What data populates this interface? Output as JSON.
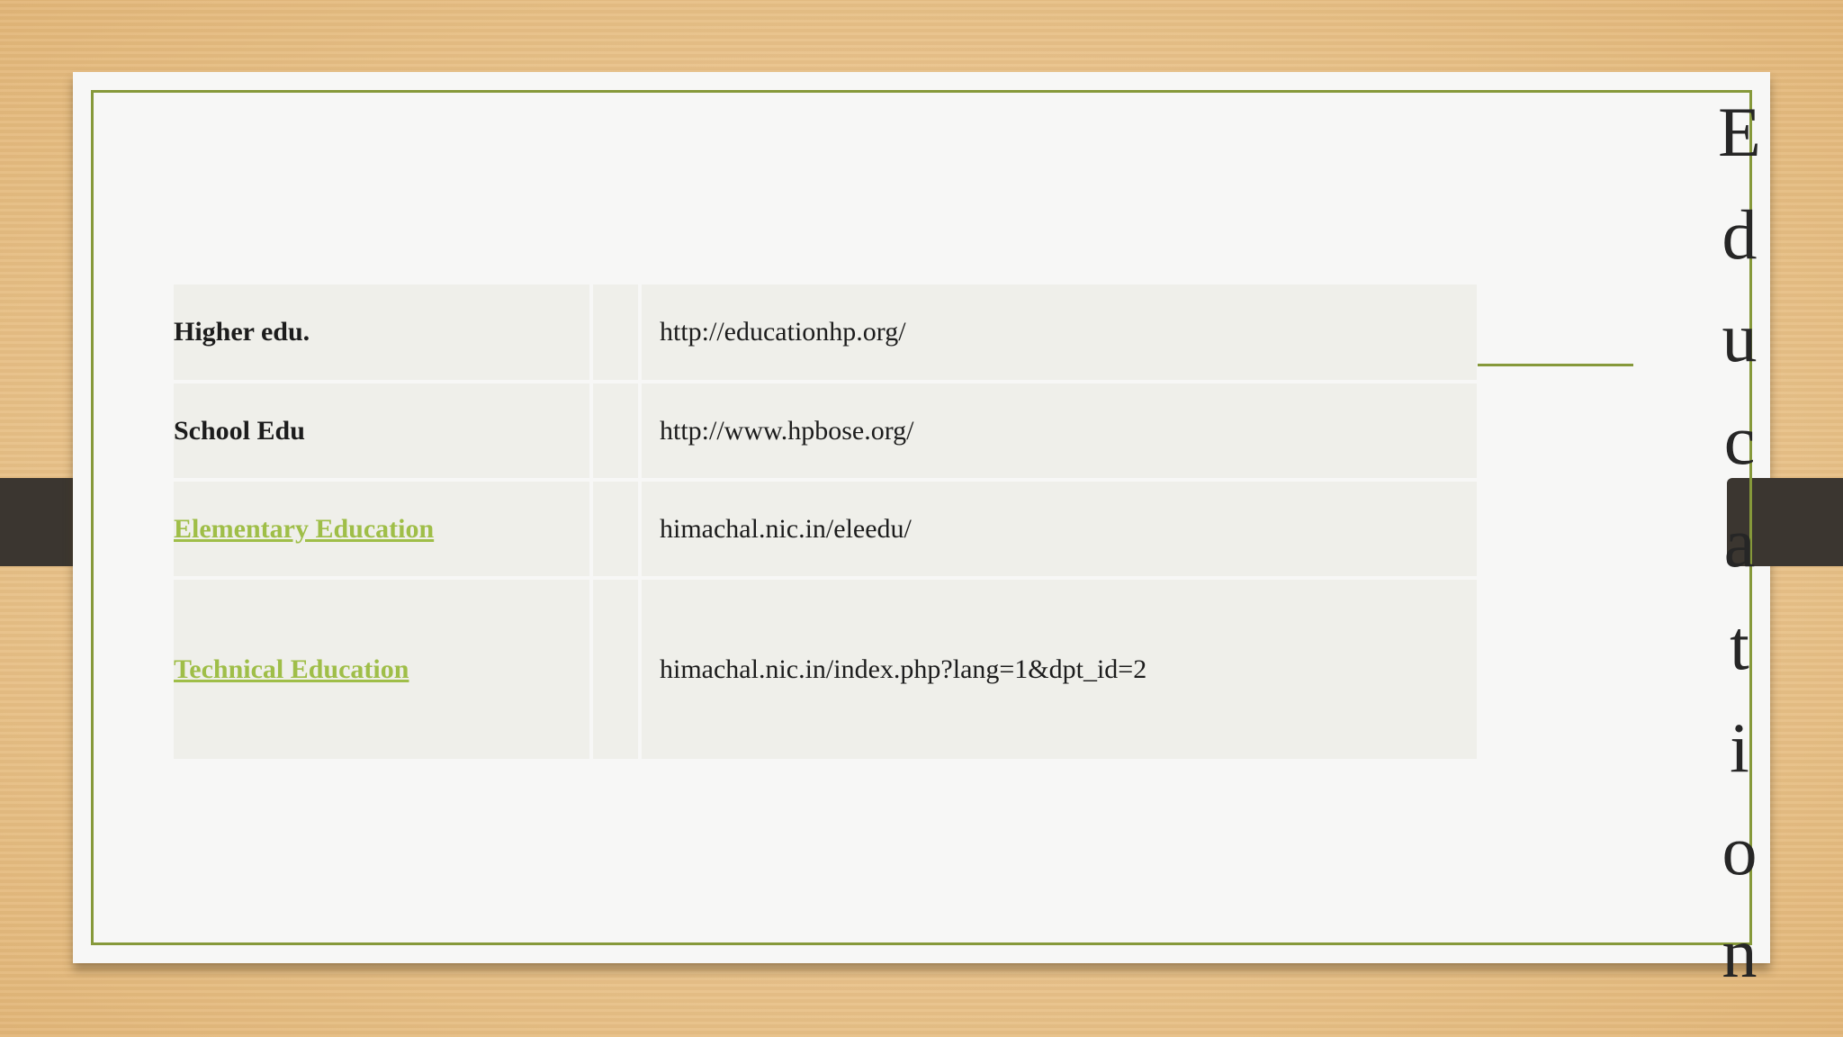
{
  "title_letters": [
    "E",
    "d",
    "u",
    "c",
    "a",
    "t",
    "i",
    "o",
    "n"
  ],
  "rows": [
    {
      "label": "Higher edu.",
      "url": "http://educationhp.org/",
      "is_link": false
    },
    {
      "label": "School Edu",
      "url": "http://www.hpbose.org/",
      "is_link": false
    },
    {
      "label": "Elementary Education",
      "url": "himachal.nic.in/eleedu/",
      "is_link": true
    },
    {
      "label": "Technical Education",
      "url": "himachal.nic.in/index.php?lang=1&dpt_id=2",
      "is_link": true
    }
  ],
  "colors": {
    "accent": "#86993a",
    "link": "#9fbe48",
    "strap": "#3b3630"
  }
}
